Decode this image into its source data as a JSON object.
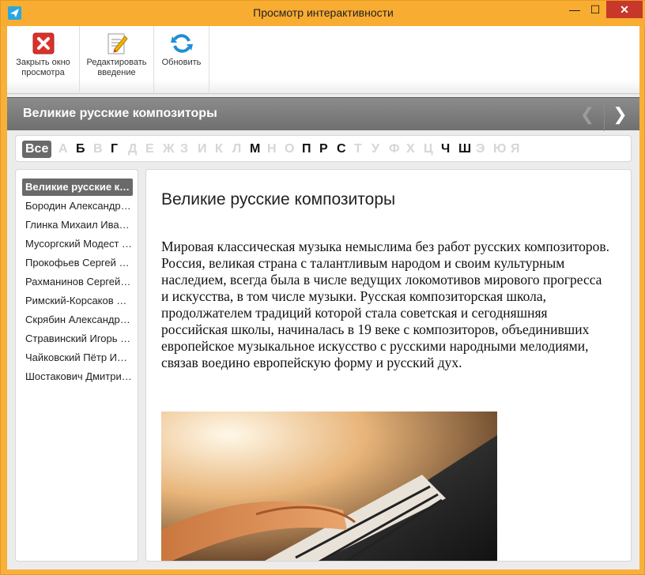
{
  "window": {
    "title": "Просмотр интерактивности",
    "min_glyph": "—",
    "max_glyph": "☐",
    "close_glyph": "✕"
  },
  "ribbon": {
    "close_label": "Закрыть окно\nпросмотра",
    "edit_label": "Редактировать\nвведение",
    "refresh_label": "Обновить"
  },
  "header": {
    "title": "Великие русские композиторы",
    "prev_glyph": "❮",
    "next_glyph": "❯"
  },
  "alphabet": {
    "letters": [
      {
        "char": "Все",
        "state": "selected"
      },
      {
        "char": "А",
        "state": "disabled"
      },
      {
        "char": "Б",
        "state": "enabled"
      },
      {
        "char": "В",
        "state": "disabled"
      },
      {
        "char": "Г",
        "state": "enabled"
      },
      {
        "char": "Д",
        "state": "disabled"
      },
      {
        "char": "Е",
        "state": "disabled"
      },
      {
        "char": "Ж",
        "state": "disabled"
      },
      {
        "char": "З",
        "state": "disabled"
      },
      {
        "char": "И",
        "state": "disabled"
      },
      {
        "char": "К",
        "state": "disabled"
      },
      {
        "char": "Л",
        "state": "disabled"
      },
      {
        "char": "М",
        "state": "enabled"
      },
      {
        "char": "Н",
        "state": "disabled"
      },
      {
        "char": "О",
        "state": "disabled"
      },
      {
        "char": "П",
        "state": "enabled"
      },
      {
        "char": "Р",
        "state": "enabled"
      },
      {
        "char": "С",
        "state": "enabled"
      },
      {
        "char": "Т",
        "state": "disabled"
      },
      {
        "char": "У",
        "state": "disabled"
      },
      {
        "char": "Ф",
        "state": "disabled"
      },
      {
        "char": "Х",
        "state": "disabled"
      },
      {
        "char": "Ц",
        "state": "disabled"
      },
      {
        "char": "Ч",
        "state": "enabled"
      },
      {
        "char": "Ш",
        "state": "enabled"
      },
      {
        "char": "Э",
        "state": "disabled"
      },
      {
        "char": "Ю",
        "state": "disabled"
      },
      {
        "char": "Я",
        "state": "disabled"
      }
    ]
  },
  "list": {
    "items": [
      {
        "label": "Великие русские композиторы",
        "selected": true
      },
      {
        "label": "Бородин Александр Порфирьевич",
        "selected": false
      },
      {
        "label": "Глинка Михаил Иванович",
        "selected": false
      },
      {
        "label": "Мусоргский Модест Петрович",
        "selected": false
      },
      {
        "label": "Прокофьев Сергей Сергеевич",
        "selected": false
      },
      {
        "label": "Рахманинов Сергей Васильевич",
        "selected": false
      },
      {
        "label": "Римский-Корсаков Николай Андреевич",
        "selected": false
      },
      {
        "label": "Скрябин Александр Николаевич",
        "selected": false
      },
      {
        "label": "Стравинский Игорь Фёдорович",
        "selected": false
      },
      {
        "label": "Чайковский Пётр Ильич",
        "selected": false
      },
      {
        "label": "Шостакович Дмитрий Дмитриевич",
        "selected": false
      }
    ]
  },
  "content": {
    "title": "Великие русские композиторы",
    "body": "Мировая классическая музыка немыслима без работ русских композиторов. Россия, великая страна с талантливым народом и своим культурным наследием, всегда была в числе ведущих локомотивов мирового прогресса и искусства, в том числе музыки. Русская композиторская школа, продолжателем традиций которой стала советская и сегодняшняя российская школы, начиналась в 19 веке с композиторов, объединивших европейское музыкальное искусство с русскими народными мелодиями, связав воедино европейскую форму и русский дух."
  },
  "icons": {
    "app": "app-icon",
    "close_preview": "close-preview-icon",
    "edit": "edit-document-icon",
    "refresh": "refresh-icon",
    "photo": "piano-photo"
  },
  "colors": {
    "window_frame": "#f8ac32",
    "close_button": "#c7372a",
    "header_bar": "#7a7a7a",
    "selected": "#6a6a6a"
  }
}
